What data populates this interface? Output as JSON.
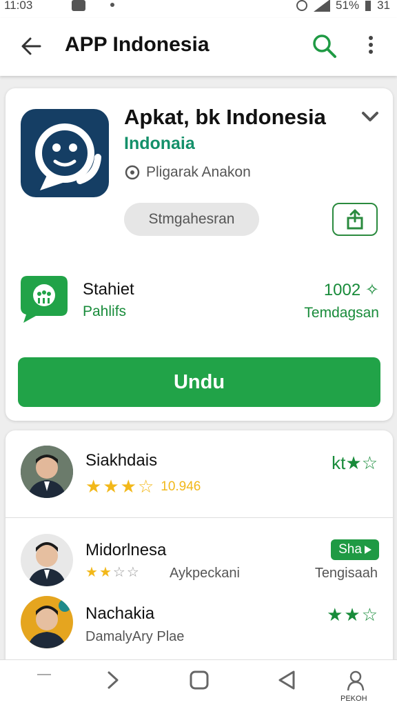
{
  "status_bar": {
    "time": "11:03",
    "battery": "51%",
    "network": "31"
  },
  "app_bar": {
    "title": "APP Indonesia"
  },
  "app": {
    "name": "Apkat, bk Indonesia",
    "subtitle": "Indonaia",
    "meta": "Pligarak Anakon",
    "pill_label": "Stmgahesran",
    "stat_title": "Stahiet",
    "stat_sub": "Pahlifs",
    "stat_value": "1002 ✧",
    "stat_value_sub": "Temdagsan",
    "install_label": "Undu"
  },
  "reviews": [
    {
      "name": "Siakhdais",
      "rating_text": "10.946",
      "top_stars": "kt★☆"
    },
    {
      "name": "Midorlnesa",
      "sub": "Aykpeckani",
      "right_sub": "Tengisaah",
      "tag": "Sha"
    },
    {
      "name": "Nachakia",
      "sub": "DamalyAry Plae"
    }
  ],
  "nav": {
    "label": "PEKOH"
  },
  "colors": {
    "primary": "#21a348",
    "icon_bg": "#153e64",
    "accent_text": "#14906a"
  }
}
